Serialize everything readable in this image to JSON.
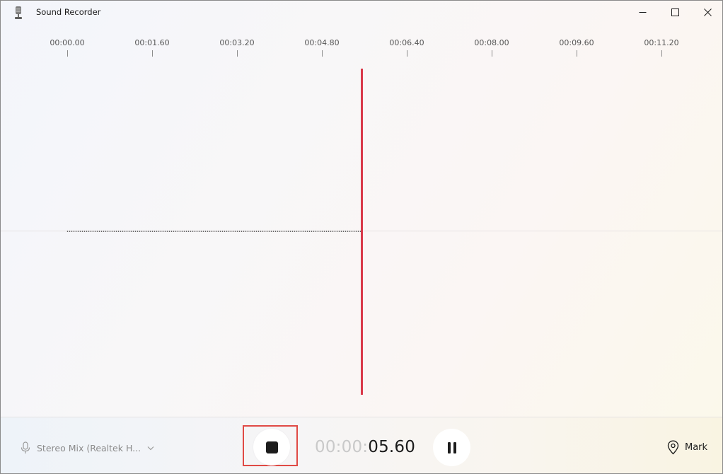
{
  "window": {
    "title": "Sound Recorder"
  },
  "timeline": {
    "ticks": [
      "00:00.00",
      "00:01.60",
      "00:03.20",
      "00:04.80",
      "00:06.40",
      "00:08.00",
      "00:09.60",
      "00:11.20"
    ]
  },
  "recording": {
    "timer_prefix": "00:00:",
    "timer_value": "05.60"
  },
  "bottombar": {
    "device_label": "Stereo Mix (Realtek H...",
    "mark_label": "Mark"
  },
  "colors": {
    "playhead": "#d9394a",
    "highlight": "#e04a45"
  },
  "icons": {
    "app": "microphone-app-icon",
    "device": "microphone-icon",
    "dropdown": "chevron-down-icon",
    "stop": "stop-icon",
    "pause": "pause-icon",
    "mark": "location-pin-icon",
    "minimize": "minimize-icon",
    "maximize": "maximize-icon",
    "close": "close-icon"
  }
}
